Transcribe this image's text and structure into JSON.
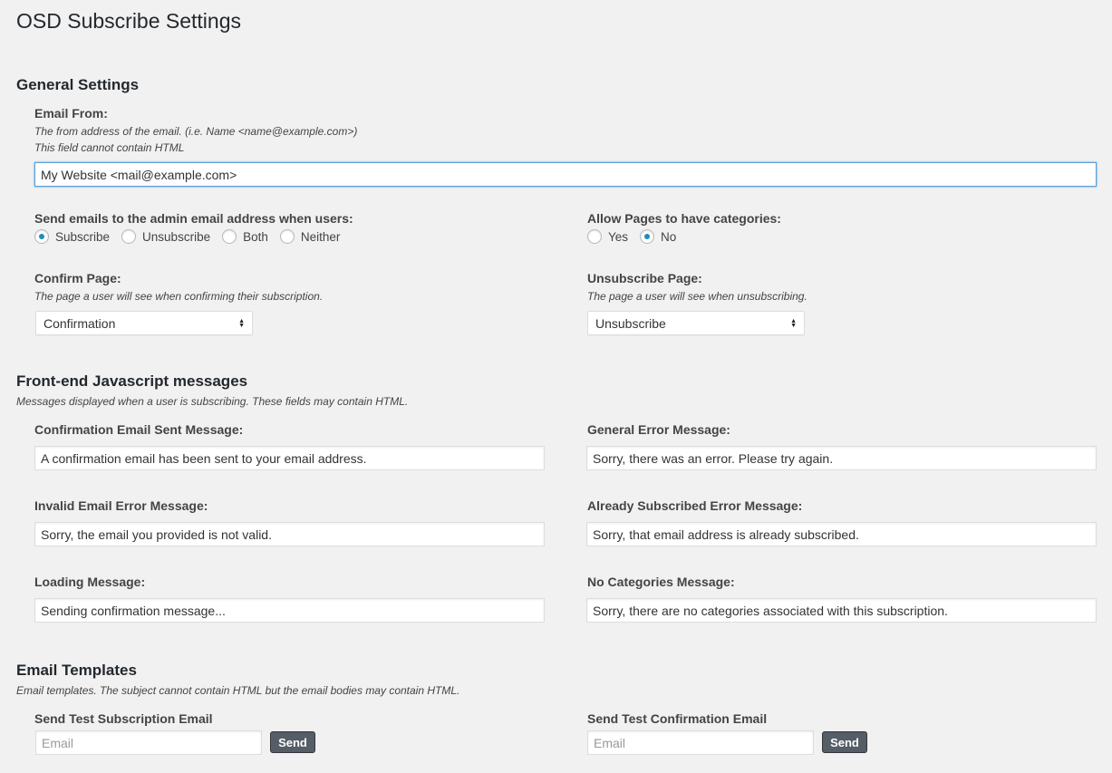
{
  "page": {
    "title": "OSD Subscribe Settings"
  },
  "general": {
    "title": "General Settings",
    "email_from": {
      "label": "Email From:",
      "desc1": "The from address of the email.  (i.e.  Name <name@example.com>)",
      "desc2": "This field cannot contain HTML",
      "value": "My Website <mail@example.com>"
    },
    "admin_notify": {
      "label": "Send emails to the admin email address when users:",
      "options": [
        "Subscribe",
        "Unsubscribe",
        "Both",
        "Neither"
      ],
      "selected": "Subscribe"
    },
    "page_categories": {
      "label": "Allow Pages to have categories:",
      "options": [
        "Yes",
        "No"
      ],
      "selected": "No"
    },
    "confirm_page": {
      "label": "Confirm Page:",
      "desc": "The page a user will see when confirming their subscription.",
      "value": "Confirmation"
    },
    "unsubscribe_page": {
      "label": "Unsubscribe Page:",
      "desc": "The page a user will see when unsubscribing.",
      "value": "Unsubscribe"
    }
  },
  "frontend": {
    "title": "Front-end Javascript messages",
    "desc": "Messages displayed when a user is subscribing. These fields may contain HTML.",
    "confirmation_sent": {
      "label": "Confirmation Email Sent Message:",
      "value": "A confirmation email has been sent to your email address."
    },
    "general_error": {
      "label": "General Error Message:",
      "value": "Sorry, there was an error. Please try again."
    },
    "invalid_email": {
      "label": "Invalid Email Error Message:",
      "value": "Sorry, the email you provided is not valid."
    },
    "already_subscribed": {
      "label": "Already Subscribed Error Message:",
      "value": "Sorry, that email address is already subscribed."
    },
    "loading": {
      "label": "Loading Message:",
      "value": "Sending confirmation message..."
    },
    "no_categories": {
      "label": "No Categories Message:",
      "value": "Sorry, there are no categories associated with this subscription."
    }
  },
  "templates": {
    "title": "Email Templates",
    "desc": "Email templates. The subject cannot contain HTML but the email bodies may contain HTML.",
    "test_subscription": {
      "label": "Send Test Subscription Email",
      "placeholder": "Email",
      "button": "Send"
    },
    "test_confirmation": {
      "label": "Send Test Confirmation Email",
      "placeholder": "Email",
      "button": "Send"
    }
  },
  "colors": {
    "accent": "#1e8cbe",
    "button": "#555d66",
    "background": "#f1f1f1"
  }
}
